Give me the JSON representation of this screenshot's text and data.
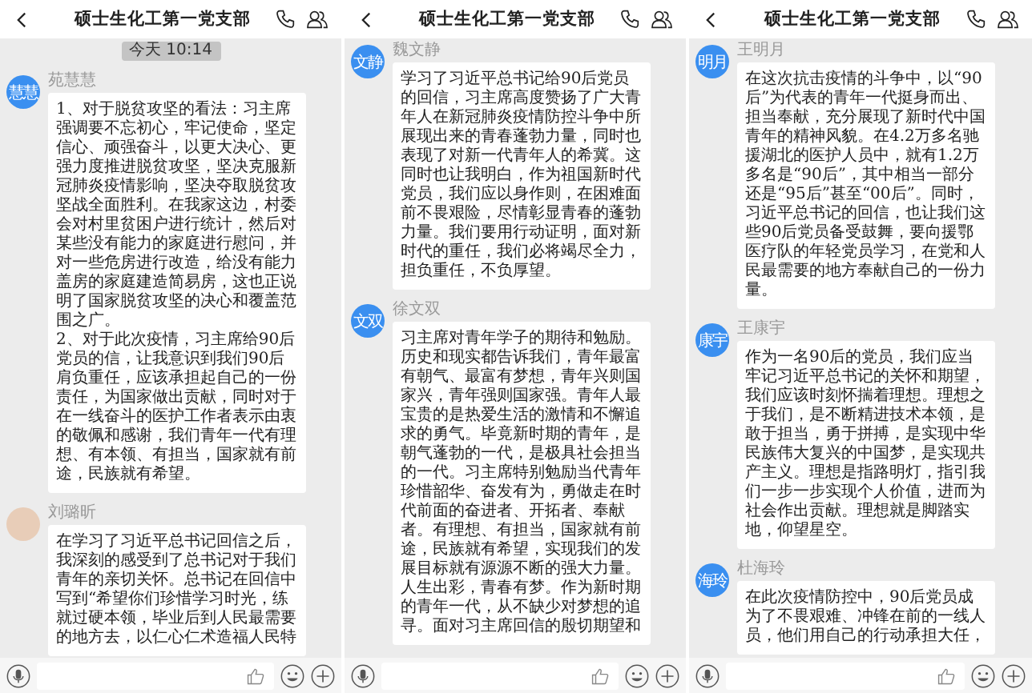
{
  "panels": [
    {
      "header": {
        "title": "硕士生化工第一党支部"
      },
      "time_badge": "今天 10:14",
      "messages": [
        {
          "sender": "苑慧慧",
          "avatar": {
            "kind": "initials",
            "text": "慧慧"
          },
          "paragraphs": [
            "1、对于脱贫攻坚的看法：习主席强调要不忘初心，牢记使命，坚定信心、顽强奋斗，以更大决心、更强力度推进脱贫攻坚，坚决克服新冠肺炎疫情影响，坚决夺取脱贫攻坚战全面胜利。在我家这边，村委会对村里贫困户进行统计，然后对某些没有能力的家庭进行慰问，并对一些危房进行改造，给没有能力盖房的家庭建造简易房，这也正说明了国家脱贫攻坚的决心和覆盖范围之广。",
            "2、对于此次疫情，习主席给90后党员的信，让我意识到我们90后肩负重任，应该承担起自己的一份责任，为国家做出贡献，同时对于在一线奋斗的医护工作者表示由衷的敬佩和感谢，我们青年一代有理想、有本领、有担当，国家就有前途，民族就有希望。"
          ]
        },
        {
          "sender": "刘璐昕",
          "avatar": {
            "kind": "photo"
          },
          "paragraphs": [
            "在学习了习近平总书记回信之后，我深刻的感受到了总书记对于我们青年的亲切关怀。总书记在回信中写到“希望你们珍惜学习时光，练就过硬本领，毕业后到人民最需要的地方去，以仁心仁术造福人民特"
          ]
        }
      ]
    },
    {
      "header": {
        "title": "硕士生化工第一党支部"
      },
      "messages": [
        {
          "sender": "魏文静",
          "avatar": {
            "kind": "initials",
            "text": "文静"
          },
          "paragraphs": [
            "学习了习近平总书记给90后党员的回信，习主席高度赞扬了广大青年人在新冠肺炎疫情防控斗争中所展现出来的青春蓬勃力量，同时也表现了对新一代青年人的希冀。这同时也让我明白，作为祖国新时代党员，我们应以身作则，在困难面前不畏艰险，尽情彰显青春的蓬勃力量。我们要用行动证明，面对新时代的重任，我们必将竭尽全力，担负重任，不负厚望。"
          ]
        },
        {
          "sender": "徐文双",
          "avatar": {
            "kind": "initials",
            "text": "文双"
          },
          "paragraphs": [
            "习主席对青年学子的期待和勉励。历史和现实都告诉我们，青年最富有朝气、最富有梦想，青年兴则国家兴，青年强则国家强。青年人最宝贵的是热爱生活的激情和不懈追求的勇气。毕竟新时期的青年，是朝气蓬勃的一代，是极具社会担当的一代。习主席特别勉励当代青年珍惜韶华、奋发有为，勇做走在时代前面的奋进者、开拓者、奉献者。有理想、有担当，国家就有前途，民族就有希望，实现我们的发展目标就有源源不断的强大力量。人生出彩，青春有梦。作为新时期的青年一代，从不缺少对梦想的追寻。面对习主席回信的殷切期望和"
          ]
        }
      ]
    },
    {
      "header": {
        "title": "硕士生化工第一党支部"
      },
      "messages": [
        {
          "sender": "王明月",
          "avatar": {
            "kind": "initials",
            "text": "明月"
          },
          "paragraphs": [
            "在这次抗击疫情的斗争中，以“90后”为代表的青年一代挺身而出、担当奉献，充分展现了新时代中国青年的精神风貌。在4.2万多名驰援湖北的医护人员中，就有1.2万多名是“90后”，其中相当一部分还是“95后”甚至“00后”。同时，习近平总书记的回信，也让我们这些90后党员备受鼓舞，要向援鄂医疗队的年轻党员学习，在党和人民最需要的地方奉献自己的一份力量。"
          ]
        },
        {
          "sender": "王康宇",
          "avatar": {
            "kind": "initials",
            "text": "康宇"
          },
          "paragraphs": [
            "作为一名90后的党员，我们应当牢记习近平总书记的关怀和期望，我们应该时刻怀揣着理想。理想之于我们，是不断精进技术本领，是敢于担当，勇于拼搏，是实现中华民族伟大复兴的中国梦，是实现共产主义。理想是指路明灯，指引我们一步一步实现个人价值，进而为社会作出贡献。理想就是脚踏实地，仰望星空。"
          ]
        },
        {
          "sender": "杜海玲",
          "avatar": {
            "kind": "initials",
            "text": "海玲"
          },
          "paragraphs": [
            "在此次疫情防控中，90后党员成为了不畏艰难、冲锋在前的一线人员，他们用自己的行动承担大任，"
          ]
        }
      ]
    }
  ]
}
